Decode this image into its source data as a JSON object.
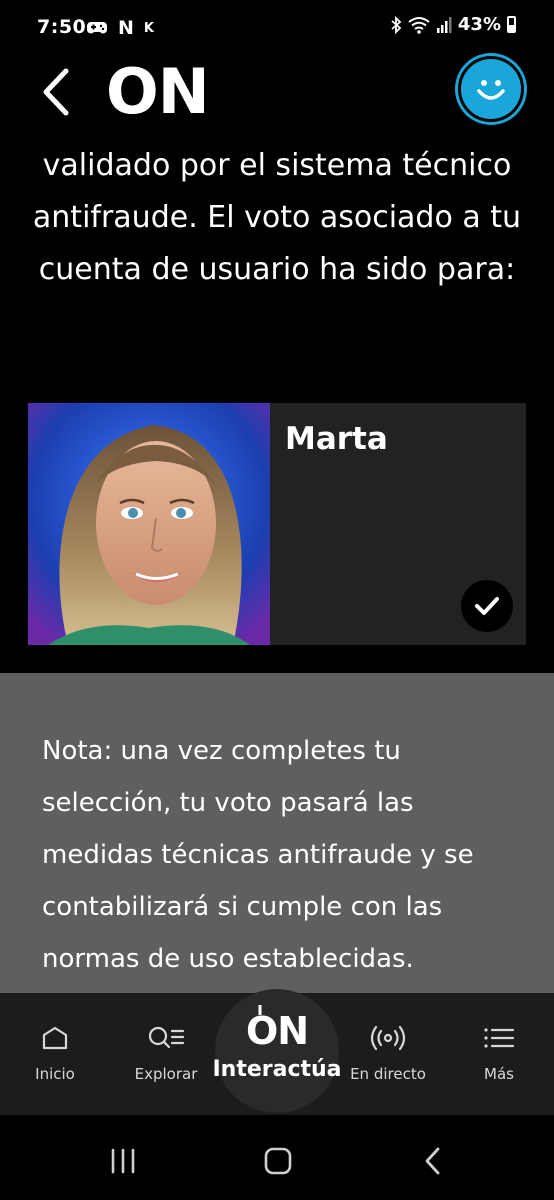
{
  "status_bar": {
    "time": "7:50",
    "notif_icons": [
      "game-controller-icon",
      "N",
      "K"
    ],
    "battery": "43%"
  },
  "header": {
    "logo": "ON",
    "back_icon": "chevron-left-icon",
    "profile_icon": "smiley-face-icon",
    "accent_color": "#1aa6d8"
  },
  "content": {
    "intro_text": "Será contabilizado una vez sea validado por el sistema técnico antifraude. El voto asociado a tu cuenta de usuario ha sido para:",
    "candidate": {
      "name": "Marta",
      "selected": true
    },
    "note": "Nota: una vez completes tu selección, tu voto pasará las medidas técnicas antifraude y se contabilizará si cumple con las normas de uso establecidas."
  },
  "bottom_nav": {
    "items": [
      {
        "label": "Inicio",
        "icon": "home-icon"
      },
      {
        "label": "Explorar",
        "icon": "search-list-icon"
      },
      {
        "label": "Interactúa",
        "icon": "on-power-logo-icon",
        "logo": "ON"
      },
      {
        "label": "En directo",
        "icon": "broadcast-icon"
      },
      {
        "label": "Más",
        "icon": "menu-list-icon"
      }
    ]
  },
  "system_nav": {
    "buttons": [
      "recent-apps-icon",
      "home-icon",
      "back-icon"
    ]
  }
}
